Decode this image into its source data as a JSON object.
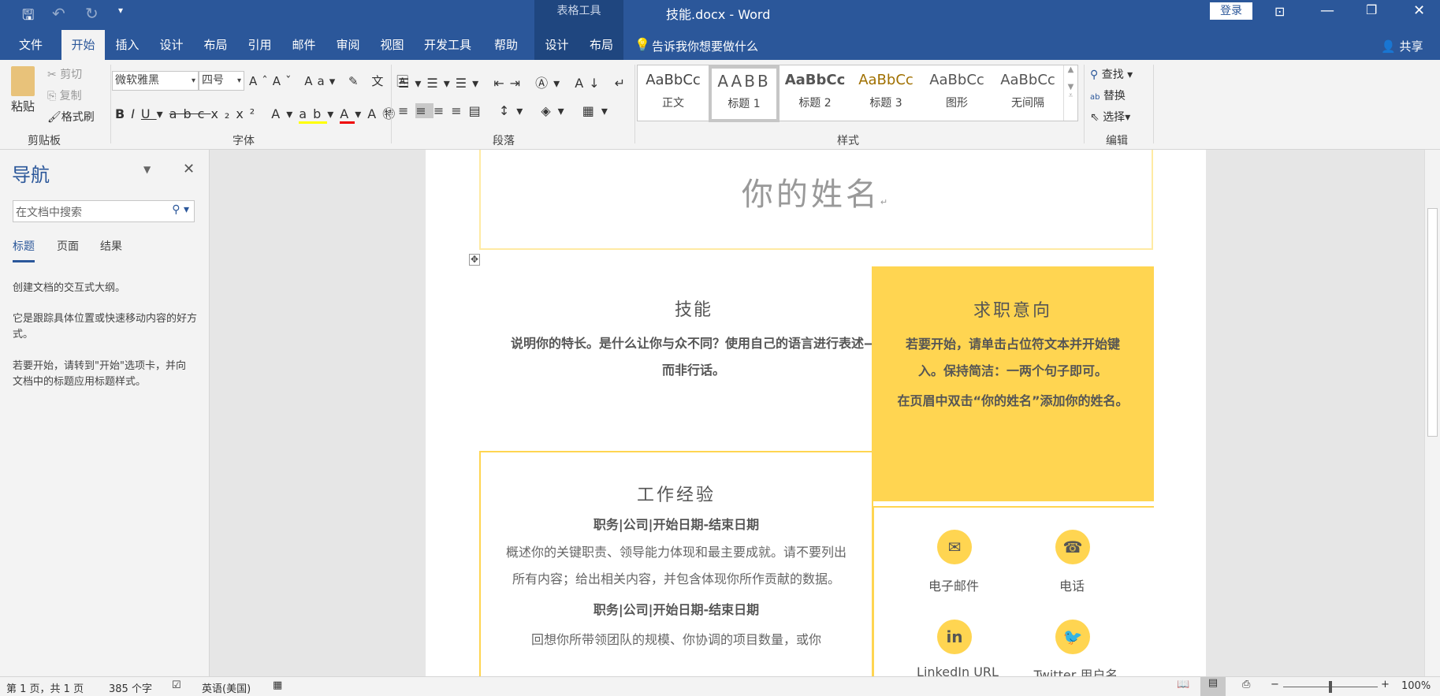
{
  "titlebar": {
    "context_group": "表格工具",
    "title": "技能.docx - Word",
    "login": "登录"
  },
  "tabs": [
    "文件",
    "开始",
    "插入",
    "设计",
    "布局",
    "引用",
    "邮件",
    "审阅",
    "视图",
    "开发工具",
    "帮助",
    "设计",
    "布局"
  ],
  "tell_me": "告诉我你想要做什么",
  "share": "共享",
  "clipboard": {
    "paste": "粘贴",
    "cut": "剪切",
    "copy": "复制",
    "format_painter": "格式刷",
    "label": "剪贴板"
  },
  "font": {
    "name": "微软雅黑",
    "size": "四号",
    "label": "字体"
  },
  "paragraph": {
    "label": "段落"
  },
  "styles": {
    "items": [
      {
        "preview": "AaBbCc",
        "name": "正文"
      },
      {
        "preview": "AABB",
        "name": "标题 1"
      },
      {
        "preview": "AaBbCc",
        "name": "标题 2"
      },
      {
        "preview": "AaBbCc",
        "name": "标题 3"
      },
      {
        "preview": "AaBbCc",
        "name": "图形"
      },
      {
        "preview": "AaBbCc",
        "name": "无间隔"
      }
    ],
    "label": "样式"
  },
  "editing": {
    "find": "查找",
    "replace": "替换",
    "select": "选择",
    "label": "编辑"
  },
  "nav": {
    "title": "导航",
    "search_placeholder": "在文档中搜索",
    "tabs": [
      "标题",
      "页面",
      "结果"
    ],
    "p1": "创建文档的交互式大纲。",
    "p2": "它是跟踪具体位置或快速移动内容的好方式。",
    "p3": "若要开始，请转到\"开始\"选项卡，并向文档中的标题应用标题样式。"
  },
  "doc": {
    "name": "你的姓名",
    "skills_title": "技能",
    "skills_body": "说明你的特长。是什么让你与众不同？使用自己的语言进行表述—而非行话。",
    "objective_title": "求职意向",
    "objective_body1": "若要开始，请单击占位符文本并开始键入。保持简洁：一两个句子即可。",
    "objective_body2": "在页眉中双击“你的姓名”添加你的姓名。",
    "work_title": "工作经验",
    "job1": "职务|公司|开始日期-结束日期",
    "job1_desc": "概述你的关键职责、领导能力体现和最主要成就。请不要列出所有内容；给出相关内容，并包含体现你所作贡献的数据。",
    "job2": "职务|公司|开始日期-结束日期",
    "job2_desc": "回想你所带领团队的规模、你协调的项目数量，或你",
    "email": "电子邮件",
    "phone": "电话",
    "linkedin": "LinkedIn URL",
    "twitter": "Twitter 用户名"
  },
  "status": {
    "page": "第 1 页，共 1 页",
    "words": "385 个字",
    "lang": "英语(美国)",
    "zoom": "100%"
  },
  "colors": {
    "accent": "#2b579a",
    "yellow": "#ffd551"
  }
}
